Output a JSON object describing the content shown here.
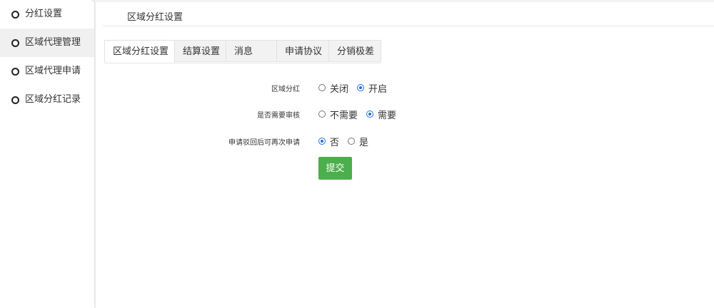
{
  "sidebar": {
    "items": [
      {
        "label": "分红设置"
      },
      {
        "label": "区域代理管理"
      },
      {
        "label": "区域代理申请"
      },
      {
        "label": "区域分红记录"
      }
    ]
  },
  "header": {
    "title": "区域分红设置"
  },
  "tabs": [
    {
      "label": "区域分红设置"
    },
    {
      "label": "结算设置"
    },
    {
      "label": "消息"
    },
    {
      "label": "申请协议"
    },
    {
      "label": "分销极差"
    }
  ],
  "form": {
    "fields": [
      {
        "label": "区域分红",
        "options": [
          {
            "label": "关闭",
            "checked": false
          },
          {
            "label": "开启",
            "checked": true
          }
        ]
      },
      {
        "label": "是否需要审核",
        "options": [
          {
            "label": "不需要",
            "checked": false
          },
          {
            "label": "需要",
            "checked": true
          }
        ]
      },
      {
        "label": "申请驳回后可再次申请",
        "options": [
          {
            "label": "否",
            "checked": true
          },
          {
            "label": "是",
            "checked": false
          }
        ]
      }
    ],
    "submit_label": "提交"
  },
  "colors": {
    "accent": "#1a73e8",
    "submit": "#4cae4c"
  }
}
